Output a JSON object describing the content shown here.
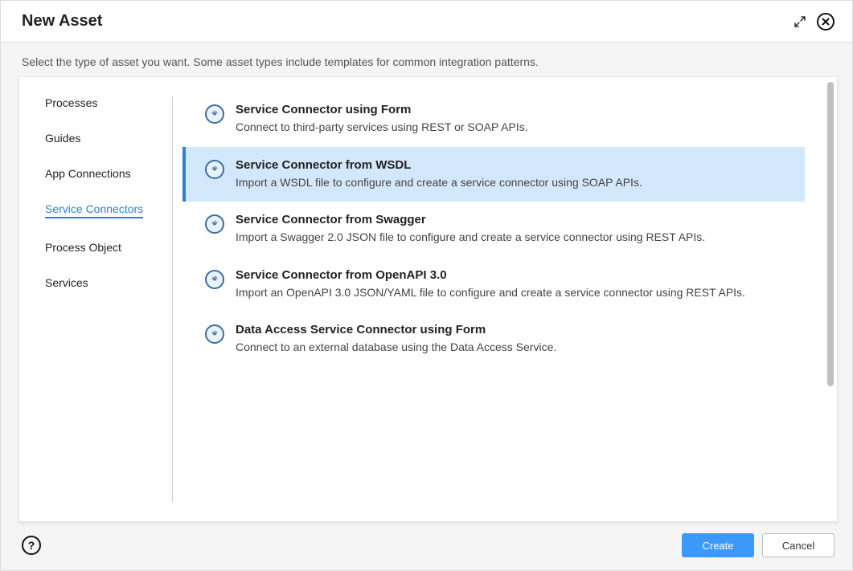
{
  "titlebar": {
    "title": "New Asset"
  },
  "subtitle": "Select the type of asset you want. Some asset types include templates for common integration patterns.",
  "sidebar": {
    "items": [
      {
        "label": "Processes",
        "active": false
      },
      {
        "label": "Guides",
        "active": false
      },
      {
        "label": "App Connections",
        "active": false
      },
      {
        "label": "Service Connectors",
        "active": true
      },
      {
        "label": "Process Object",
        "active": false
      },
      {
        "label": "Services",
        "active": false
      }
    ]
  },
  "options": [
    {
      "title": "Service Connector using Form",
      "desc": "Connect to third-party services using REST or SOAP APIs.",
      "selected": false
    },
    {
      "title": "Service Connector from WSDL",
      "desc": "Import a WSDL file to configure and create a service connector using SOAP APIs.",
      "selected": true
    },
    {
      "title": "Service Connector from Swagger",
      "desc": "Import a Swagger 2.0 JSON file to configure and create a service connector using REST APIs.",
      "selected": false
    },
    {
      "title": "Service Connector from OpenAPI 3.0",
      "desc": "Import an OpenAPI 3.0 JSON/YAML file to configure and create a service connector using REST APIs.",
      "selected": false
    },
    {
      "title": "Data Access Service Connector using Form",
      "desc": "Connect to an external database using the Data Access Service.",
      "selected": false
    }
  ],
  "footer": {
    "help_label": "?",
    "create_label": "Create",
    "cancel_label": "Cancel"
  },
  "colors": {
    "accent": "#2d7fdd",
    "selection_bg": "#d4e8fb",
    "primary_button": "#3b99fc"
  }
}
